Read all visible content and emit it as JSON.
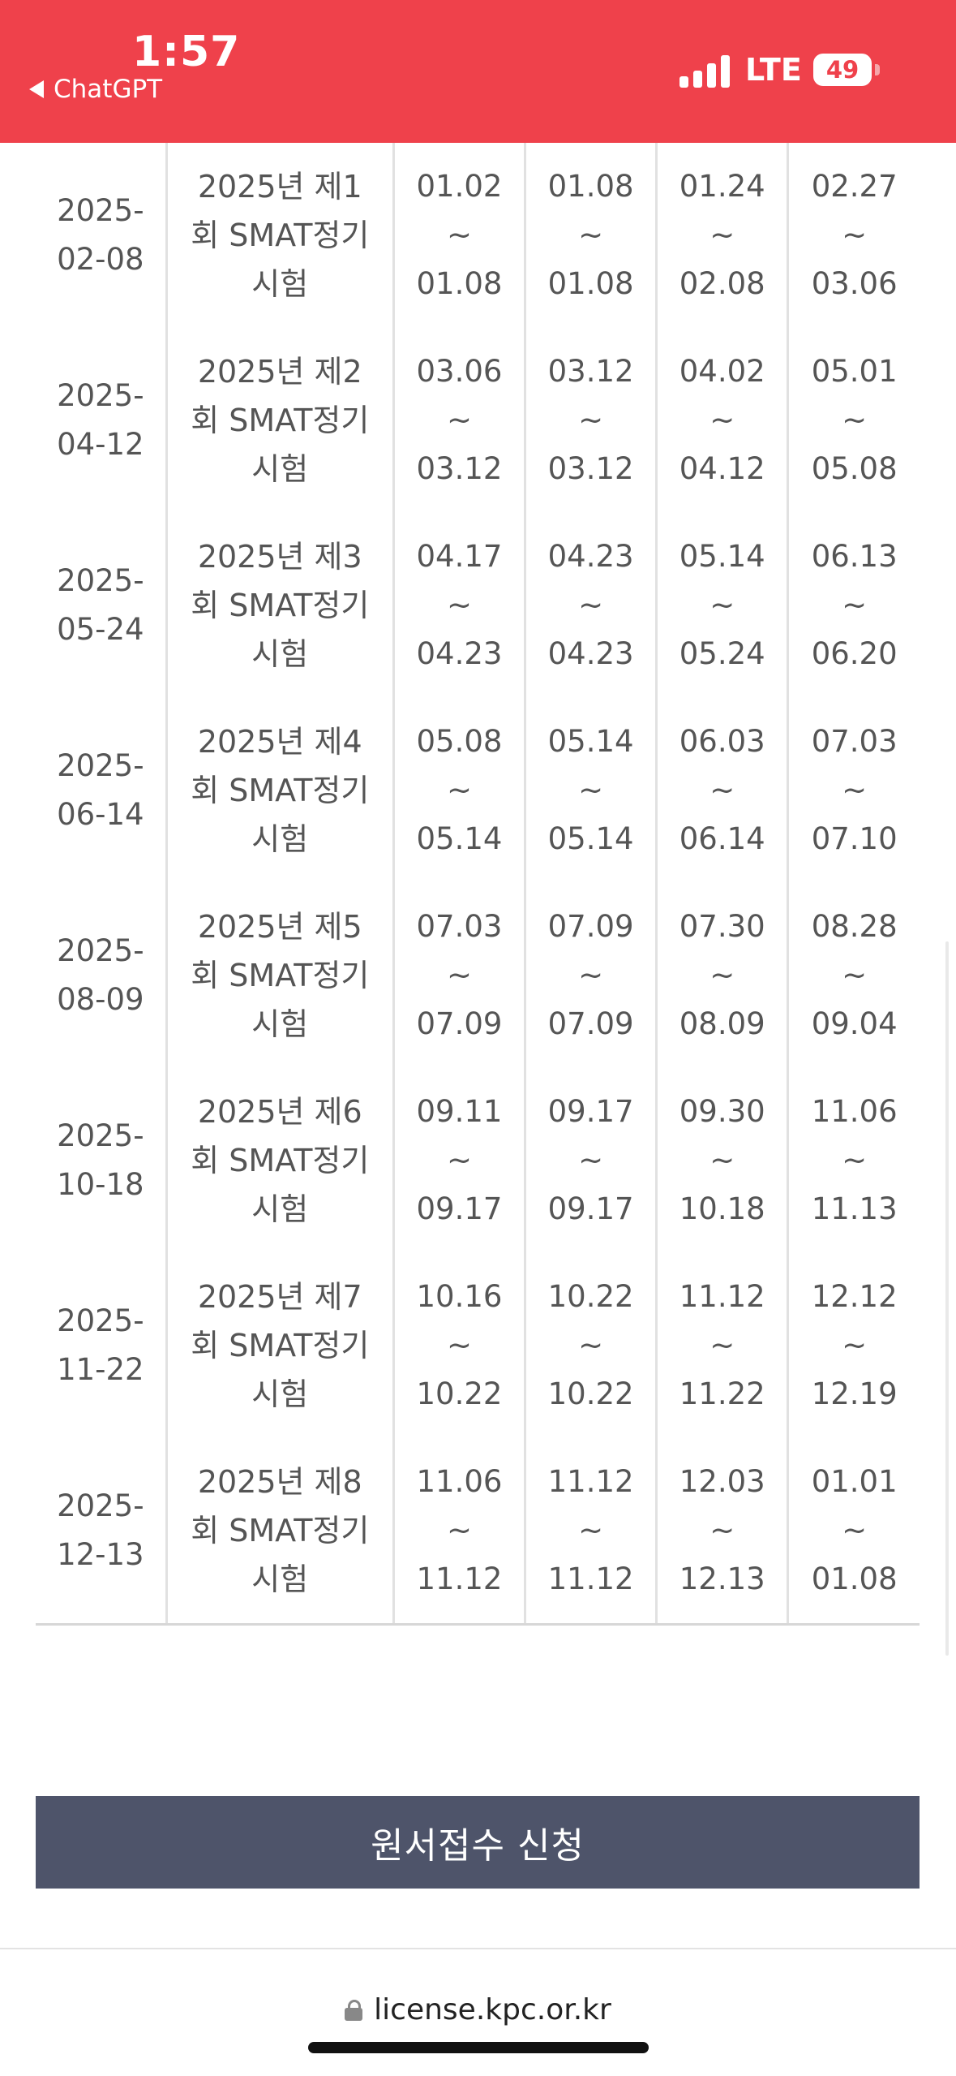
{
  "status_bar": {
    "time": "1:57",
    "back_app": "ChatGPT",
    "network": "LTE",
    "battery": "49",
    "accent_color": "#ef414b"
  },
  "table": {
    "rows": [
      {
        "date_year": "2025-",
        "date_md": "02-08",
        "name_line1": "2025년 제1",
        "name_line2": "회 SMAT정기",
        "name_line3": "시험",
        "p1_start": "01.02",
        "p1_sep": "~",
        "p1_end": "01.08",
        "p2_start": "01.08",
        "p2_sep": "~",
        "p2_end": "01.08",
        "p3_start": "01.24",
        "p3_sep": "~",
        "p3_end": "02.08",
        "p4_start": "02.27",
        "p4_sep": "~",
        "p4_end": "03.06"
      },
      {
        "date_year": "2025-",
        "date_md": "04-12",
        "name_line1": "2025년 제2",
        "name_line2": "회 SMAT정기",
        "name_line3": "시험",
        "p1_start": "03.06",
        "p1_sep": "~",
        "p1_end": "03.12",
        "p2_start": "03.12",
        "p2_sep": "~",
        "p2_end": "03.12",
        "p3_start": "04.02",
        "p3_sep": "~",
        "p3_end": "04.12",
        "p4_start": "05.01",
        "p4_sep": "~",
        "p4_end": "05.08"
      },
      {
        "date_year": "2025-",
        "date_md": "05-24",
        "name_line1": "2025년 제3",
        "name_line2": "회 SMAT정기",
        "name_line3": "시험",
        "p1_start": "04.17",
        "p1_sep": "~",
        "p1_end": "04.23",
        "p2_start": "04.23",
        "p2_sep": "~",
        "p2_end": "04.23",
        "p3_start": "05.14",
        "p3_sep": "~",
        "p3_end": "05.24",
        "p4_start": "06.13",
        "p4_sep": "~",
        "p4_end": "06.20"
      },
      {
        "date_year": "2025-",
        "date_md": "06-14",
        "name_line1": "2025년 제4",
        "name_line2": "회 SMAT정기",
        "name_line3": "시험",
        "p1_start": "05.08",
        "p1_sep": "~",
        "p1_end": "05.14",
        "p2_start": "05.14",
        "p2_sep": "~",
        "p2_end": "05.14",
        "p3_start": "06.03",
        "p3_sep": "~",
        "p3_end": "06.14",
        "p4_start": "07.03",
        "p4_sep": "~",
        "p4_end": "07.10"
      },
      {
        "date_year": "2025-",
        "date_md": "08-09",
        "name_line1": "2025년 제5",
        "name_line2": "회 SMAT정기",
        "name_line3": "시험",
        "p1_start": "07.03",
        "p1_sep": "~",
        "p1_end": "07.09",
        "p2_start": "07.09",
        "p2_sep": "~",
        "p2_end": "07.09",
        "p3_start": "07.30",
        "p3_sep": "~",
        "p3_end": "08.09",
        "p4_start": "08.28",
        "p4_sep": "~",
        "p4_end": "09.04"
      },
      {
        "date_year": "2025-",
        "date_md": "10-18",
        "name_line1": "2025년 제6",
        "name_line2": "회 SMAT정기",
        "name_line3": "시험",
        "p1_start": "09.11",
        "p1_sep": "~",
        "p1_end": "09.17",
        "p2_start": "09.17",
        "p2_sep": "~",
        "p2_end": "09.17",
        "p3_start": "09.30",
        "p3_sep": "~",
        "p3_end": "10.18",
        "p4_start": "11.06",
        "p4_sep": "~",
        "p4_end": "11.13"
      },
      {
        "date_year": "2025-",
        "date_md": "11-22",
        "name_line1": "2025년 제7",
        "name_line2": "회 SMAT정기",
        "name_line3": "시험",
        "p1_start": "10.16",
        "p1_sep": "~",
        "p1_end": "10.22",
        "p2_start": "10.22",
        "p2_sep": "~",
        "p2_end": "10.22",
        "p3_start": "11.12",
        "p3_sep": "~",
        "p3_end": "11.22",
        "p4_start": "12.12",
        "p4_sep": "~",
        "p4_end": "12.19"
      },
      {
        "date_year": "2025-",
        "date_md": "12-13",
        "name_line1": "2025년 제8",
        "name_line2": "회 SMAT정기",
        "name_line3": "시험",
        "p1_start": "11.06",
        "p1_sep": "~",
        "p1_end": "11.12",
        "p2_start": "11.12",
        "p2_sep": "~",
        "p2_end": "11.12",
        "p3_start": "12.03",
        "p3_sep": "~",
        "p3_end": "12.13",
        "p4_start": "01.01",
        "p4_sep": "~",
        "p4_end": "01.08"
      }
    ]
  },
  "apply_button": {
    "label": "원서접수 신청",
    "color": "#4e546a"
  },
  "url_bar": {
    "url": "license.kpc.or.kr"
  }
}
